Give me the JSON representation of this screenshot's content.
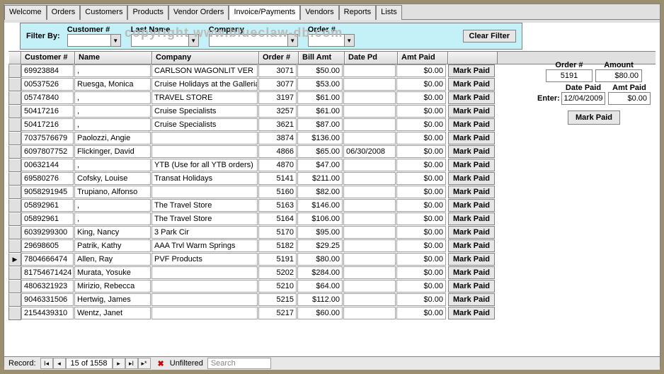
{
  "tabs": [
    "Welcome",
    "Orders",
    "Customers",
    "Products",
    "Vendor Orders",
    "Invoice/Payments",
    "Vendors",
    "Reports",
    "Lists"
  ],
  "active_tab": 5,
  "watermark": "copyright www.blueclaw-db.com",
  "filter": {
    "label": "Filter By:",
    "customer_cap": "Customer #",
    "lastname_cap": "Last Name",
    "company_cap": "Company",
    "order_cap": "Order #",
    "clear_btn": "Clear Filter"
  },
  "headers": {
    "cust": "Customer #",
    "name": "Name",
    "comp": "Company",
    "ord": "Order #",
    "bill": "Bill Amt",
    "date": "Date Pd",
    "amt": "Amt Paid"
  },
  "mark_paid": "Mark Paid",
  "rows": [
    {
      "cust": "69923884",
      "name": ",",
      "comp": "CARLSON WAGONLIT VER",
      "ord": "3071",
      "bill": "$50.00",
      "date": "",
      "amt": "$0.00"
    },
    {
      "cust": "00537526",
      "name": "Ruesga, Monica",
      "comp": "Cruise Holidays at the Galleria",
      "ord": "3077",
      "bill": "$53.00",
      "date": "",
      "amt": "$0.00"
    },
    {
      "cust": "05747840",
      "name": ",",
      "comp": "TRAVEL STORE",
      "ord": "3197",
      "bill": "$61.00",
      "date": "",
      "amt": "$0.00"
    },
    {
      "cust": "50417216",
      "name": ",",
      "comp": "Cruise Specialists",
      "ord": "3257",
      "bill": "$61.00",
      "date": "",
      "amt": "$0.00"
    },
    {
      "cust": "50417216",
      "name": ",",
      "comp": "Cruise Specialists",
      "ord": "3621",
      "bill": "$87.00",
      "date": "",
      "amt": "$0.00"
    },
    {
      "cust": "7037576679",
      "name": "Paolozzi, Angie",
      "comp": "",
      "ord": "3874",
      "bill": "$136.00",
      "date": "",
      "amt": "$0.00"
    },
    {
      "cust": "6097807752",
      "name": "Flickinger, David",
      "comp": "",
      "ord": "4866",
      "bill": "$65.00",
      "date": "06/30/2008",
      "amt": "$0.00"
    },
    {
      "cust": "00632144",
      "name": ",",
      "comp": "YTB (Use for all YTB orders)",
      "ord": "4870",
      "bill": "$47.00",
      "date": "",
      "amt": "$0.00"
    },
    {
      "cust": "69580276",
      "name": "Cofsky, Louise",
      "comp": "Transat Holidays",
      "ord": "5141",
      "bill": "$211.00",
      "date": "",
      "amt": "$0.00"
    },
    {
      "cust": "9058291945",
      "name": "Trupiano, Alfonso",
      "comp": "",
      "ord": "5160",
      "bill": "$82.00",
      "date": "",
      "amt": "$0.00"
    },
    {
      "cust": "05892961",
      "name": ",",
      "comp": "The Travel Store",
      "ord": "5163",
      "bill": "$146.00",
      "date": "",
      "amt": "$0.00"
    },
    {
      "cust": "05892961",
      "name": ",",
      "comp": "The Travel Store",
      "ord": "5164",
      "bill": "$106.00",
      "date": "",
      "amt": "$0.00"
    },
    {
      "cust": "6039299300",
      "name": "King, Nancy",
      "comp": "3 Park Cir",
      "ord": "5170",
      "bill": "$95.00",
      "date": "",
      "amt": "$0.00"
    },
    {
      "cust": "29698605",
      "name": "Patrik, Kathy",
      "comp": "AAA Trvl Warm Springs",
      "ord": "5182",
      "bill": "$29.25",
      "date": "",
      "amt": "$0.00"
    },
    {
      "cust": "7804666474",
      "name": "Allen, Ray",
      "comp": "PVF Products",
      "ord": "5191",
      "bill": "$80.00",
      "date": "",
      "amt": "$0.00",
      "sel": true
    },
    {
      "cust": "81754671424",
      "name": "Murata, Yosuke",
      "comp": "",
      "ord": "5202",
      "bill": "$284.00",
      "date": "",
      "amt": "$0.00"
    },
    {
      "cust": "4806321923",
      "name": "Mirizio, Rebecca",
      "comp": "",
      "ord": "5210",
      "bill": "$64.00",
      "date": "",
      "amt": "$0.00"
    },
    {
      "cust": "9046331506",
      "name": "Hertwig, James",
      "comp": "",
      "ord": "5215",
      "bill": "$112.00",
      "date": "",
      "amt": "$0.00"
    },
    {
      "cust": "2154439310",
      "name": "Wentz, Janet",
      "comp": "",
      "ord": "5217",
      "bill": "$60.00",
      "date": "",
      "amt": "$0.00"
    }
  ],
  "side": {
    "order_lbl": "Order #",
    "amount_lbl": "Amount",
    "order_val": "5191",
    "amount_val": "$80.00",
    "datepaid_lbl": "Date Paid",
    "amtpaid_lbl": "Amt Paid",
    "enter_lbl": "Enter:",
    "date_val": "12/04/2009",
    "amt_val": "$0.00",
    "btn": "Mark Paid"
  },
  "nav": {
    "label": "Record:",
    "pos": "15 of 1558",
    "unfiltered": "Unfiltered",
    "search": "Search"
  }
}
